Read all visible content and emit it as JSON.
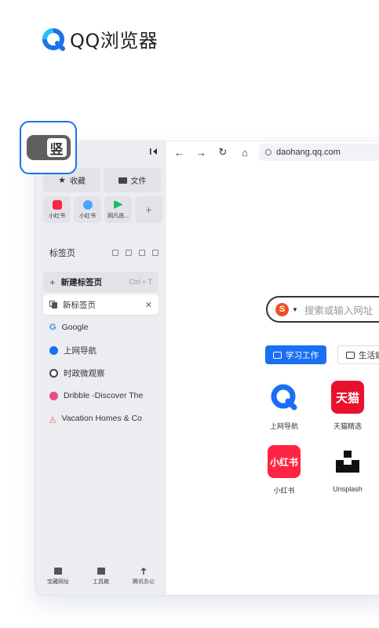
{
  "brand": {
    "name": "QQ浏览器"
  },
  "badge": {
    "char": "竖"
  },
  "sidebar": {
    "top_buttons": [
      {
        "label": "收藏",
        "icon": "star-icon"
      },
      {
        "label": "文件",
        "icon": "folder-icon"
      }
    ],
    "apps": [
      {
        "label": "小红书",
        "color": "#ff2442"
      },
      {
        "label": "小红书",
        "color": "#4aa3ff"
      },
      {
        "label": "网凡迭...",
        "color": "#1fb86d"
      }
    ],
    "tabs_title": "标签页",
    "new_tab": {
      "label": "新建标签页",
      "shortcut": "Ctrl + T"
    },
    "active_tab": {
      "label": "新标签页"
    },
    "tabs": [
      {
        "label": "Google",
        "color": "#4285f4"
      },
      {
        "label": "上网导航",
        "color": "#1a6ff3"
      },
      {
        "label": "时政微观察",
        "color": "#444444"
      },
      {
        "label": "Dribble -Discover The",
        "color": "#ea4c89"
      },
      {
        "label": "Vacation Homes & Co",
        "color": "#ff5a5f"
      }
    ],
    "bottom": [
      {
        "label": "宝藏网址"
      },
      {
        "label": "工具箱"
      },
      {
        "label": "腾讯办公"
      }
    ]
  },
  "navbar": {
    "url": "daohang.qq.com"
  },
  "search": {
    "placeholder": "搜索或输入网址",
    "engine": "S"
  },
  "categories": [
    {
      "label": "学习工作",
      "active": true
    },
    {
      "label": "生活娱",
      "active": false
    }
  ],
  "sites": [
    {
      "label": "上网导航",
      "icon_text": "",
      "color": "#1a6ff3"
    },
    {
      "label": "天猫精选",
      "icon_text": "天猫",
      "color": "#e8112d"
    },
    {
      "label": "小红书",
      "icon_text": "小红书",
      "color": "#ff2442"
    },
    {
      "label": "Unsplash",
      "icon_text": "",
      "color": "#111111"
    }
  ],
  "colors": {
    "accent": "#1a6ff3",
    "sidebar_bg": "#ecedf1"
  }
}
